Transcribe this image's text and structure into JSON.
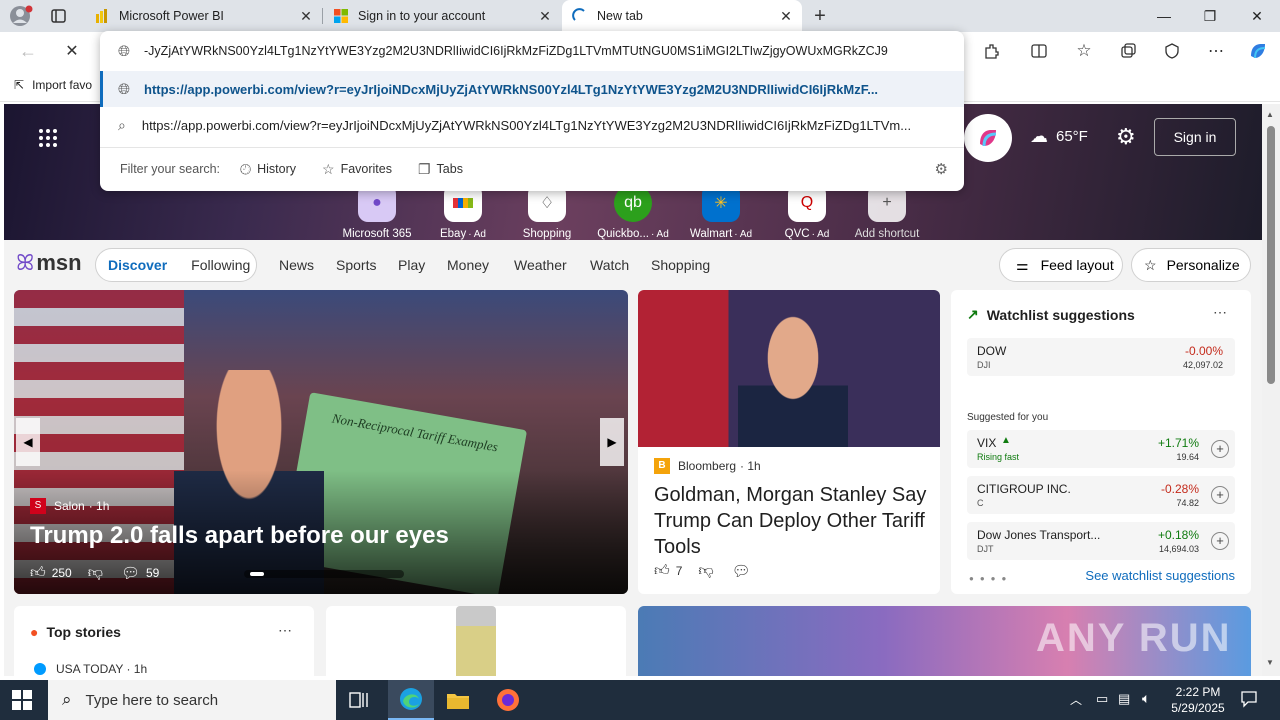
{
  "tabs": [
    {
      "title": "Microsoft Power BI"
    },
    {
      "title": "Sign in to your account"
    },
    {
      "title": "New tab"
    }
  ],
  "omnibox": {
    "input_value": "-JyZjAtYWRkNS00Yzl4LTg1NzYtYWE3Yzg2M2U3NDRlIiwidCI6IjRkMzFiZDg1LTVmMTUtNGU0MS1iMGI2LTIwZjgyOWUxMGRkZCJ9",
    "suggestion1": "https://app.powerbi.com/view?r=eyJrIjoiNDcxMjUyZjAtYWRkNS00Yzl4LTg1NzYtYWE3Yzg2M2U3NDRlIiwidCI6IjRkMzF...",
    "suggestion2": "https://app.powerbi.com/view?r=eyJrIjoiNDcxMjUyZjAtYWRkNS00Yzl4LTg1NzYtYWE3Yzg2M2U3NDRlIiwidCI6IjRkMzFiZDg1LTVm...",
    "filter_label": "Filter your search:",
    "filter_history": "History",
    "filter_favorites": "Favorites",
    "filter_tabs": "Tabs"
  },
  "bookmarks": {
    "import": "Import favo"
  },
  "header": {
    "weather": "65°F",
    "signin": "Sign in"
  },
  "shortcuts": [
    {
      "label": "Microsoft 365",
      "ad": ""
    },
    {
      "label": "Ebay",
      "ad": "· Ad"
    },
    {
      "label": "Shopping",
      "ad": ""
    },
    {
      "label": "Quickbo...",
      "ad": "· Ad"
    },
    {
      "label": "Walmart",
      "ad": "· Ad"
    },
    {
      "label": "QVC",
      "ad": "· Ad"
    },
    {
      "label": "Add shortcut",
      "ad": ""
    }
  ],
  "nav": {
    "brand": "msn",
    "discover": "Discover",
    "following": "Following",
    "links": [
      "News",
      "Sports",
      "Play",
      "Money",
      "Weather",
      "Watch",
      "Shopping"
    ],
    "feed_layout": "Feed layout",
    "personalize": "Personalize"
  },
  "hero_story": {
    "source": "Salon",
    "age": "· 1h",
    "headline": "Trump 2.0 falls apart before our eyes",
    "likes": "250",
    "comments": "59",
    "sign_text": "Non-Reciprocal Tariff Examples"
  },
  "side_story": {
    "source": "Bloomberg",
    "age": "· 1h",
    "headline": "Goldman, Morgan Stanley Say Trump Can Deploy Other Tariff Tools",
    "likes": "7"
  },
  "watchlist": {
    "title": "Watchlist suggestions",
    "suggested_label": "Suggested for you",
    "see_more": "See watchlist suggestions",
    "items": [
      {
        "name": "DOW",
        "ticker": "DJI",
        "change": "-0.00%",
        "price": "42,097.02",
        "color": "#c42b1c"
      },
      {
        "name": "VIX",
        "ticker": "Rising fast",
        "change": "+1.71%",
        "price": "19.64",
        "color": "#0f7b0f"
      },
      {
        "name": "CITIGROUP INC.",
        "ticker": "C",
        "change": "-0.28%",
        "price": "74.82",
        "color": "#c42b1c"
      },
      {
        "name": "Dow Jones Transport...",
        "ticker": "DJT",
        "change": "+0.18%",
        "price": "14,694.03",
        "color": "#0f7b0f"
      }
    ]
  },
  "top_stories": {
    "title": "Top stories",
    "first_source": "USA TODAY · 1h"
  },
  "taskbar": {
    "search_placeholder": "Type here to search",
    "time": "2:22 PM",
    "date": "5/29/2025"
  },
  "watermark": "ANY RUN"
}
